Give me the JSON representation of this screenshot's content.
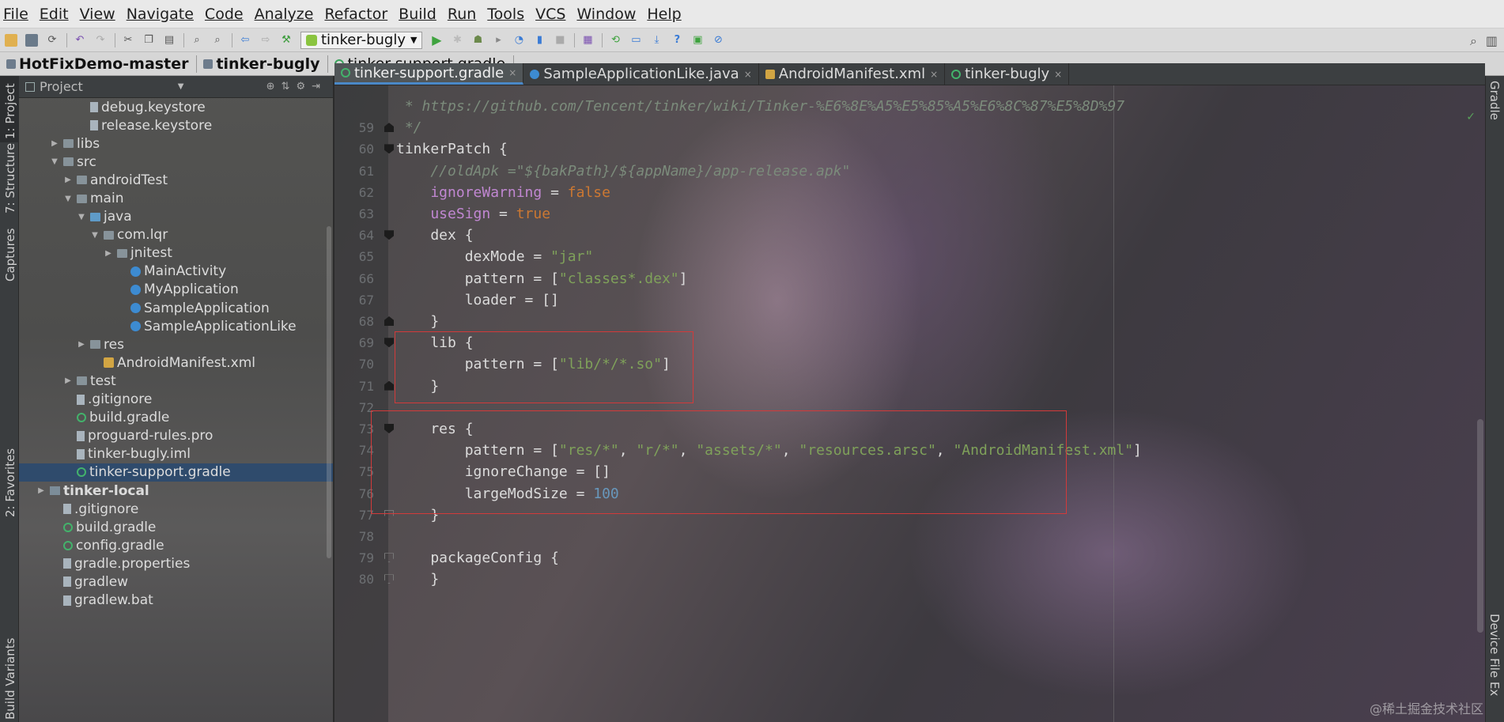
{
  "menu": [
    "File",
    "Edit",
    "View",
    "Navigate",
    "Code",
    "Analyze",
    "Refactor",
    "Build",
    "Run",
    "Tools",
    "VCS",
    "Window",
    "Help"
  ],
  "toolbar": {
    "run_config": "tinker-bugly"
  },
  "breadcrumb": [
    "HotFixDemo-master",
    "tinker-bugly",
    "tinker-support.gradle"
  ],
  "left_strip": [
    "1: Project",
    "7: Structure",
    "Captures",
    "2: Favorites",
    "Build Variants"
  ],
  "right_strip": [
    "Gradle",
    "Device File Ex"
  ],
  "project_panel": {
    "title": "Project",
    "tree": [
      {
        "label": "debug.keystore",
        "depth": 4,
        "icon": "file",
        "arrow": ""
      },
      {
        "label": "release.keystore",
        "depth": 4,
        "icon": "file",
        "arrow": ""
      },
      {
        "label": "libs",
        "depth": 2,
        "icon": "folder",
        "arrow": "▶"
      },
      {
        "label": "src",
        "depth": 2,
        "icon": "folder",
        "arrow": "▼"
      },
      {
        "label": "androidTest",
        "depth": 3,
        "icon": "folder",
        "arrow": "▶"
      },
      {
        "label": "main",
        "depth": 3,
        "icon": "folder",
        "arrow": "▼"
      },
      {
        "label": "java",
        "depth": 4,
        "icon": "folder-src",
        "arrow": "▼"
      },
      {
        "label": "com.lqr",
        "depth": 5,
        "icon": "folder",
        "arrow": "▼"
      },
      {
        "label": "jnitest",
        "depth": 6,
        "icon": "folder",
        "arrow": "▶"
      },
      {
        "label": "MainActivity",
        "depth": 7,
        "icon": "java",
        "arrow": ""
      },
      {
        "label": "MyApplication",
        "depth": 7,
        "icon": "java",
        "arrow": ""
      },
      {
        "label": "SampleApplication",
        "depth": 7,
        "icon": "java",
        "arrow": ""
      },
      {
        "label": "SampleApplicationLike",
        "depth": 7,
        "icon": "java",
        "arrow": ""
      },
      {
        "label": "res",
        "depth": 4,
        "icon": "folder",
        "arrow": "▶"
      },
      {
        "label": "AndroidManifest.xml",
        "depth": 5,
        "icon": "xml",
        "arrow": ""
      },
      {
        "label": "test",
        "depth": 3,
        "icon": "folder",
        "arrow": "▶"
      },
      {
        "label": ".gitignore",
        "depth": 3,
        "icon": "file",
        "arrow": ""
      },
      {
        "label": "build.gradle",
        "depth": 3,
        "icon": "gradle",
        "arrow": ""
      },
      {
        "label": "proguard-rules.pro",
        "depth": 3,
        "icon": "file",
        "arrow": ""
      },
      {
        "label": "tinker-bugly.iml",
        "depth": 3,
        "icon": "file",
        "arrow": ""
      },
      {
        "label": "tinker-support.gradle",
        "depth": 3,
        "icon": "gradle",
        "arrow": "",
        "selected": true
      },
      {
        "label": "tinker-local",
        "depth": 1,
        "icon": "module",
        "arrow": "▶",
        "bold": true
      },
      {
        "label": ".gitignore",
        "depth": 2,
        "icon": "file",
        "arrow": ""
      },
      {
        "label": "build.gradle",
        "depth": 2,
        "icon": "gradle",
        "arrow": ""
      },
      {
        "label": "config.gradle",
        "depth": 2,
        "icon": "gradle",
        "arrow": ""
      },
      {
        "label": "gradle.properties",
        "depth": 2,
        "icon": "file",
        "arrow": ""
      },
      {
        "label": "gradlew",
        "depth": 2,
        "icon": "file",
        "arrow": ""
      },
      {
        "label": "gradlew.bat",
        "depth": 2,
        "icon": "file",
        "arrow": ""
      }
    ]
  },
  "editor": {
    "tabs": [
      {
        "label": "tinker-support.gradle",
        "icon": "gradle",
        "active": true
      },
      {
        "label": "SampleApplicationLike.java",
        "icon": "java",
        "active": false
      },
      {
        "label": "AndroidManifest.xml",
        "icon": "xml",
        "active": false
      },
      {
        "label": "tinker-bugly",
        "icon": "gradle",
        "active": false
      }
    ],
    "lines": [
      {
        "n": "",
        "fold": "",
        "segs": [
          [
            "c-cmt",
            " * https://github.com/Tencent/tinker/wiki/Tinker-%E6%8E%A5%E5%85%A5%E6%8C%87%E5%8D%97"
          ]
        ]
      },
      {
        "n": "59",
        "fold": "end",
        "segs": [
          [
            "c-cmt",
            " */"
          ]
        ]
      },
      {
        "n": "60",
        "fold": "start",
        "segs": [
          [
            "c-plain",
            "tinkerPatch {"
          ]
        ]
      },
      {
        "n": "61",
        "fold": "",
        "segs": [
          [
            "c-cmt",
            "    //oldApk =\"${bakPath}/${appName}/app-release.apk\""
          ]
        ]
      },
      {
        "n": "62",
        "fold": "",
        "segs": [
          [
            "c-var",
            "    ignoreWarning"
          ],
          [
            "c-plain",
            " = "
          ],
          [
            "c-kw",
            "false"
          ]
        ]
      },
      {
        "n": "63",
        "fold": "",
        "segs": [
          [
            "c-var",
            "    useSign"
          ],
          [
            "c-plain",
            " = "
          ],
          [
            "c-kw",
            "true"
          ]
        ]
      },
      {
        "n": "64",
        "fold": "start",
        "segs": [
          [
            "c-plain",
            "    dex {"
          ]
        ]
      },
      {
        "n": "65",
        "fold": "",
        "segs": [
          [
            "c-plain",
            "        dexMode = "
          ],
          [
            "c-str",
            "\"jar\""
          ]
        ]
      },
      {
        "n": "66",
        "fold": "",
        "segs": [
          [
            "c-plain",
            "        pattern = ["
          ],
          [
            "c-str",
            "\"classes*.dex\""
          ],
          [
            "c-plain",
            "]"
          ]
        ]
      },
      {
        "n": "67",
        "fold": "",
        "segs": [
          [
            "c-plain",
            "        loader = []"
          ]
        ]
      },
      {
        "n": "68",
        "fold": "end",
        "segs": [
          [
            "c-plain",
            "    }"
          ]
        ]
      },
      {
        "n": "69",
        "fold": "start",
        "segs": [
          [
            "c-plain",
            "    lib {"
          ]
        ]
      },
      {
        "n": "70",
        "fold": "",
        "segs": [
          [
            "c-plain",
            "        pattern = ["
          ],
          [
            "c-str",
            "\"lib/*/*.so\""
          ],
          [
            "c-plain",
            "]"
          ]
        ]
      },
      {
        "n": "71",
        "fold": "end",
        "segs": [
          [
            "c-plain",
            "    }"
          ]
        ]
      },
      {
        "n": "72",
        "fold": "",
        "segs": []
      },
      {
        "n": "73",
        "fold": "start",
        "segs": [
          [
            "c-plain",
            "    res {"
          ]
        ]
      },
      {
        "n": "74",
        "fold": "",
        "segs": [
          [
            "c-plain",
            "        pattern = ["
          ],
          [
            "c-str",
            "\"res/*\""
          ],
          [
            "c-plain",
            ", "
          ],
          [
            "c-str",
            "\"r/*\""
          ],
          [
            "c-plain",
            ", "
          ],
          [
            "c-str",
            "\"assets/*\""
          ],
          [
            "c-plain",
            ", "
          ],
          [
            "c-str",
            "\"resources.arsc\""
          ],
          [
            "c-plain",
            ", "
          ],
          [
            "c-str",
            "\"AndroidManifest.xml\""
          ],
          [
            "c-plain",
            "]"
          ]
        ]
      },
      {
        "n": "75",
        "fold": "",
        "segs": [
          [
            "c-plain",
            "        ignoreChange = []"
          ]
        ]
      },
      {
        "n": "76",
        "fold": "",
        "segs": [
          [
            "c-plain",
            "        largeModSize = "
          ],
          [
            "c-num",
            "100"
          ]
        ]
      },
      {
        "n": "77",
        "fold": "empty",
        "segs": [
          [
            "c-plain",
            "    }"
          ]
        ]
      },
      {
        "n": "78",
        "fold": "",
        "segs": []
      },
      {
        "n": "79",
        "fold": "empty",
        "segs": [
          [
            "c-plain",
            "    packageConfig {"
          ]
        ]
      },
      {
        "n": "80",
        "fold": "empty",
        "segs": [
          [
            "c-plain",
            "    }"
          ]
        ]
      }
    ]
  },
  "watermark": "@稀土掘金技术社区"
}
